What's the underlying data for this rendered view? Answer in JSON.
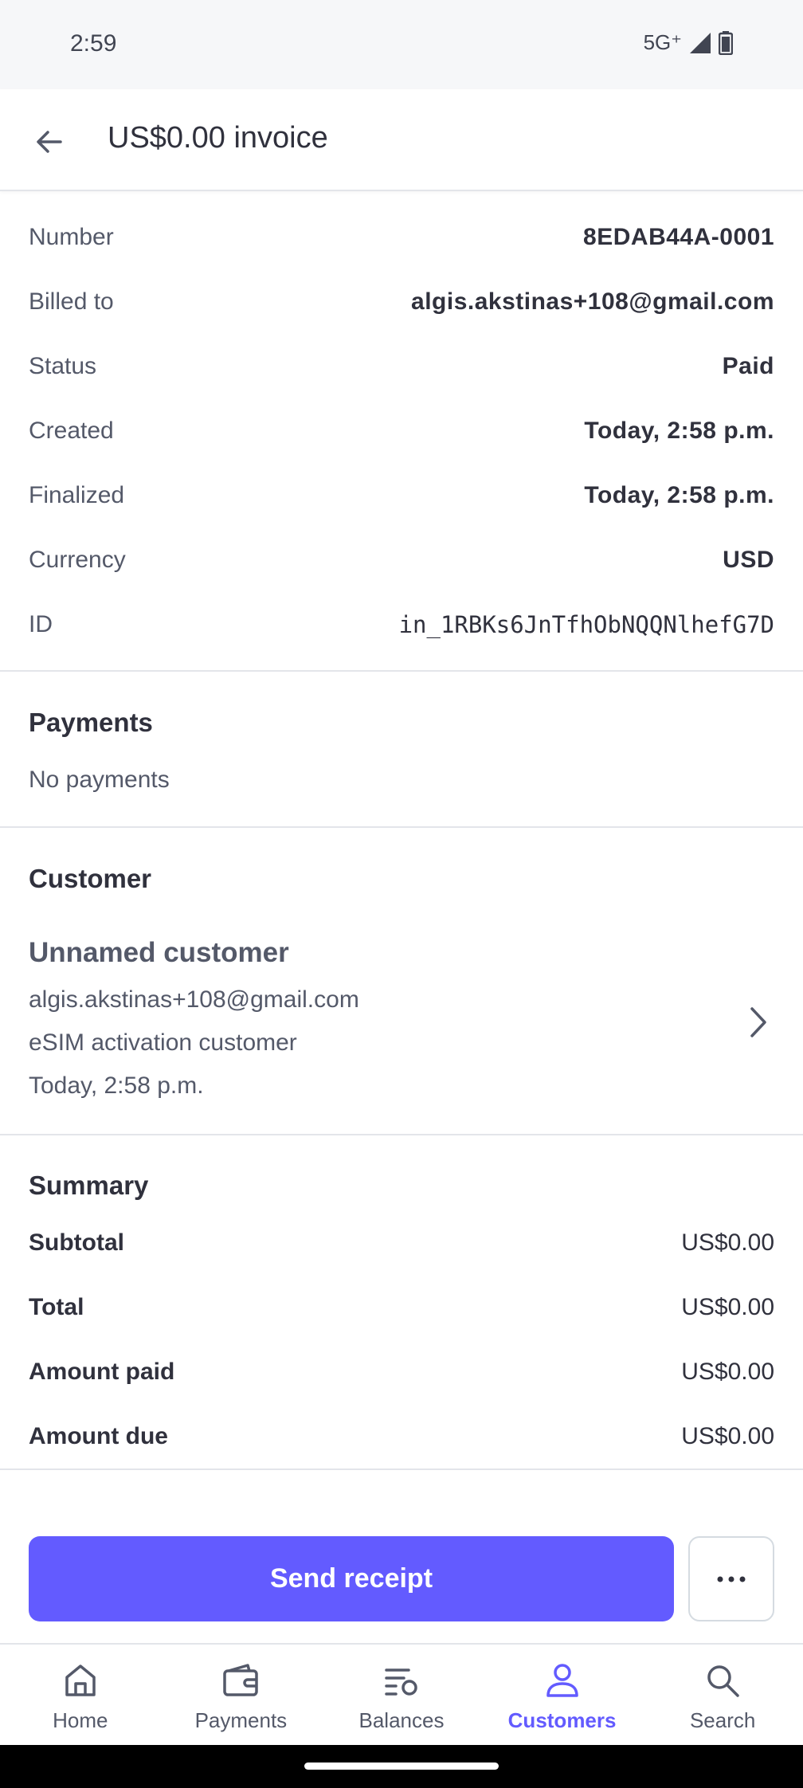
{
  "status_bar": {
    "time": "2:59",
    "network": "5G⁺"
  },
  "app_bar": {
    "title": "US$0.00 invoice"
  },
  "details": [
    {
      "label": "Number",
      "value": "8EDAB44A-0001",
      "mono": false
    },
    {
      "label": "Billed to",
      "value": "algis.akstinas+108@gmail.com",
      "mono": false
    },
    {
      "label": "Status",
      "value": "Paid",
      "mono": false
    },
    {
      "label": "Created",
      "value": "Today, 2:58 p.m.",
      "mono": false
    },
    {
      "label": "Finalized",
      "value": "Today, 2:58 p.m.",
      "mono": false
    },
    {
      "label": "Currency",
      "value": "USD",
      "mono": false
    },
    {
      "label": "ID",
      "value": "in_1RBKs6JnTfhObNQQNlhefG7D",
      "mono": true
    }
  ],
  "payments": {
    "title": "Payments",
    "empty_text": "No payments"
  },
  "customer": {
    "title": "Customer",
    "name": "Unnamed customer",
    "email": "algis.akstinas+108@gmail.com",
    "description": "eSIM activation customer",
    "created": "Today, 2:58 p.m."
  },
  "summary": {
    "title": "Summary",
    "rows": [
      {
        "label": "Subtotal",
        "value": "US$0.00"
      },
      {
        "label": "Total",
        "value": "US$0.00"
      },
      {
        "label": "Amount paid",
        "value": "US$0.00"
      },
      {
        "label": "Amount due",
        "value": "US$0.00"
      }
    ]
  },
  "actions": {
    "send_receipt": "Send receipt",
    "more_icon": "more-horizontal-icon"
  },
  "bottom_nav": [
    {
      "label": "Home",
      "icon": "home-icon",
      "active": false
    },
    {
      "label": "Payments",
      "icon": "wallet-icon",
      "active": false
    },
    {
      "label": "Balances",
      "icon": "balances-icon",
      "active": false
    },
    {
      "label": "Customers",
      "icon": "person-icon",
      "active": true
    },
    {
      "label": "Search",
      "icon": "search-icon",
      "active": false
    }
  ],
  "colors": {
    "accent": "#635bff",
    "text": "#30313d",
    "muted": "#545969",
    "divider": "#e3e5ea"
  }
}
